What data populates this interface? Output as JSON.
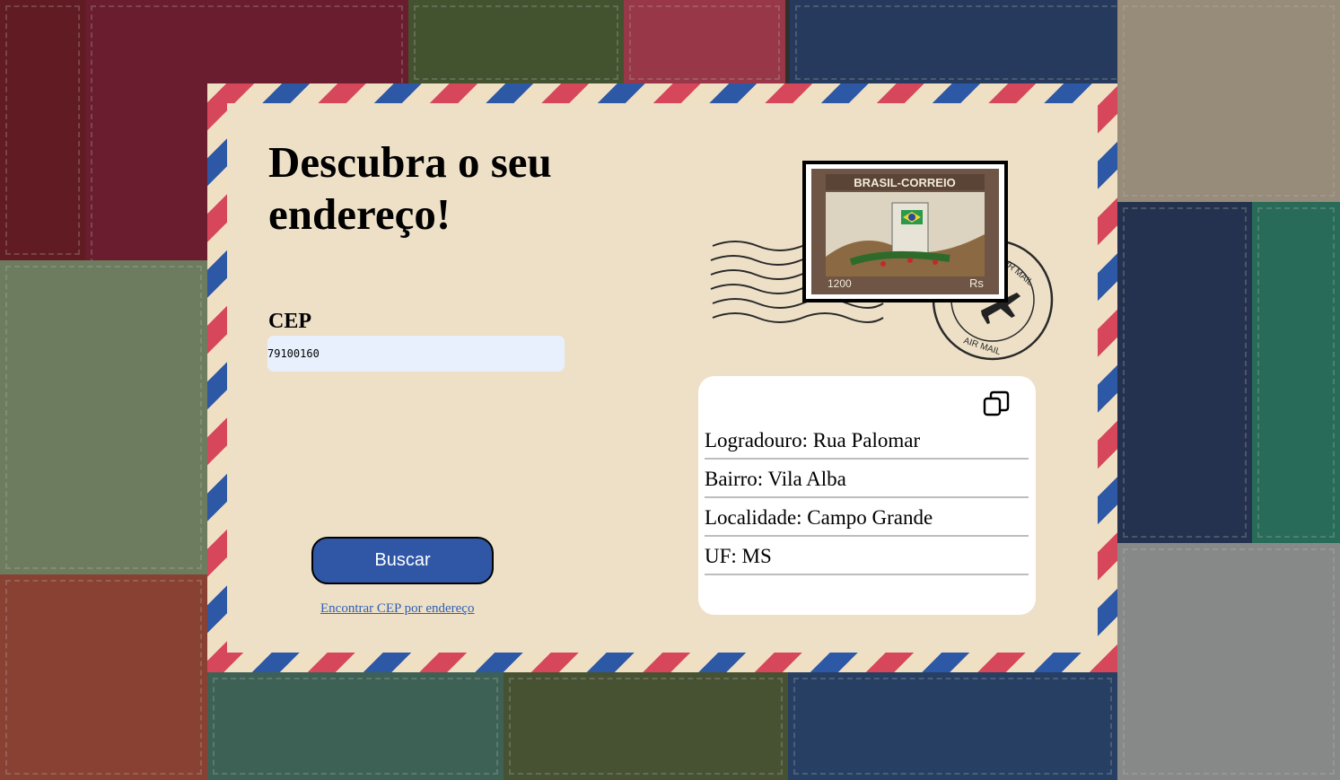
{
  "page": {
    "title": "Descubra o seu endereço!"
  },
  "form": {
    "cep_label": "CEP",
    "cep_value": "79100160",
    "search_label": "Buscar",
    "find_cep_link": "Encontrar CEP por endereço"
  },
  "stamp": {
    "header_text": "BRASIL-CORREIO",
    "value_left": "1200",
    "value_right": "Rs",
    "postmark_text": "AIR MAIL"
  },
  "result": {
    "logradouro": "Logradouro: Rua Palomar",
    "bairro": "Bairro: Vila Alba",
    "localidade": "Localidade: Campo Grande",
    "uf": "UF: MS",
    "copy_icon": "copy-icon"
  },
  "colors": {
    "airmail_red": "#d7475c",
    "airmail_blue": "#2d58a6",
    "envelope": "#efdfc3",
    "button": "#2f57a6",
    "input_bg": "#e8f0fe"
  }
}
